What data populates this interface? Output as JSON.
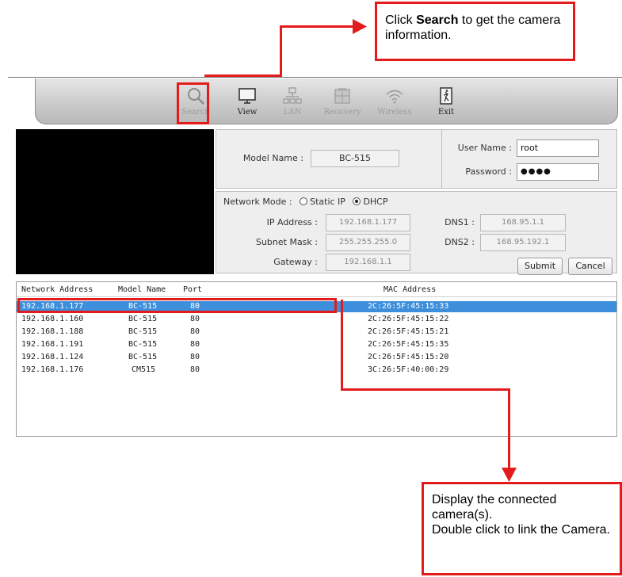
{
  "callouts": {
    "top_bold": "Search",
    "top_pre": "Click ",
    "top_post": " to get the camera information.",
    "bottom_line1": "Display the connected camera(s).",
    "bottom_line2": "Double click to link the Camera."
  },
  "toolbar": {
    "items": [
      {
        "label": "Search",
        "icon": "magnifier-icon",
        "enabled": false
      },
      {
        "label": "View",
        "icon": "monitor-icon",
        "enabled": true
      },
      {
        "label": "LAN",
        "icon": "lan-icon",
        "enabled": false
      },
      {
        "label": "Recovery",
        "icon": "recovery-icon",
        "enabled": false
      },
      {
        "label": "Wireless",
        "icon": "wifi-icon",
        "enabled": false
      },
      {
        "label": "Exit",
        "icon": "exit-icon",
        "enabled": true
      }
    ]
  },
  "model": {
    "label": "Model Name :",
    "value": "BC-515"
  },
  "login": {
    "user_label": "User Name :",
    "user_value": "root",
    "pass_label": "Password :",
    "pass_value": "●●●●"
  },
  "network": {
    "mode_label": "Network Mode :",
    "mode_static": "Static IP",
    "mode_dhcp": "DHCP",
    "selected_mode": "DHCP",
    "ip_label": "IP Address :",
    "ip_value": "192.168.1.177",
    "subnet_label": "Subnet Mask :",
    "subnet_value": "255.255.255.0",
    "gateway_label": "Gateway :",
    "gateway_value": "192.168.1.1",
    "dns1_label": "DNS1 :",
    "dns1_value": "168.95.1.1",
    "dns2_label": "DNS2 :",
    "dns2_value": "168.95.192.1",
    "submit": "Submit",
    "cancel": "Cancel"
  },
  "list": {
    "headers": [
      "Network Address",
      "Model Name",
      "Port",
      "MAC Address"
    ],
    "rows": [
      [
        "192.168.1.177",
        "BC-515",
        "80",
        "2C:26:5F:45:15:33"
      ],
      [
        "192.168.1.160",
        "BC-515",
        "80",
        "2C:26:5F:45:15:22"
      ],
      [
        "192.168.1.188",
        "BC-515",
        "80",
        "2C:26:5F:45:15:21"
      ],
      [
        "192.168.1.191",
        "BC-515",
        "80",
        "2C:26:5F:45:15:35"
      ],
      [
        "192.168.1.124",
        "BC-515",
        "80",
        "2C:26:5F:45:15:20"
      ],
      [
        "192.168.1.176",
        "CM515",
        "80",
        "3C:26:5F:40:00:29"
      ]
    ],
    "selected_row": 0
  },
  "colors": {
    "annotation": "#e31b1b",
    "selection": "#3d8fdc"
  }
}
